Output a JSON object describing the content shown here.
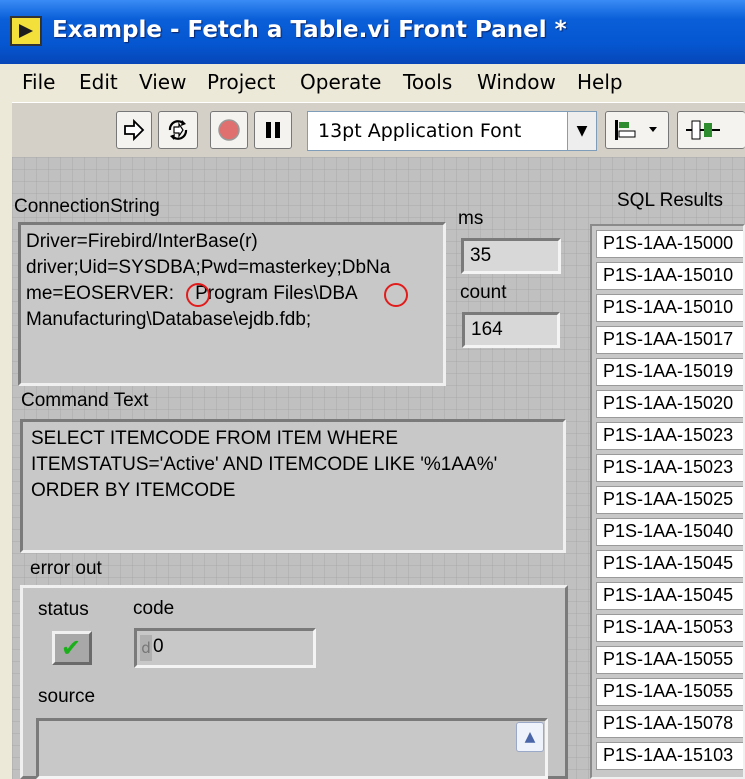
{
  "window": {
    "title": "Example - Fetch a Table.vi Front Panel *"
  },
  "menu": [
    "File",
    "Edit",
    "View",
    "Project",
    "Operate",
    "Tools",
    "Window",
    "Help"
  ],
  "toolbar": {
    "font": "13pt Application Font"
  },
  "connection": {
    "label": "ConnectionString",
    "value": "Driver=Firebird/InterBase(r)\ndriver;Uid=SYSDBA;Pwd=masterkey;DbNa\nme=EOSERVER:    Program Files\\DBA\nManufacturing\\Database\\ejdb.fdb;"
  },
  "ms": {
    "label": "ms",
    "value": "35"
  },
  "count": {
    "label": "count",
    "value": "164"
  },
  "command": {
    "label": "Command Text",
    "value": "SELECT ITEMCODE FROM ITEM WHERE\nITEMSTATUS='Active' AND ITEMCODE LIKE '%1AA%'\nORDER BY ITEMCODE"
  },
  "results": {
    "label": "SQL Results",
    "rows": [
      "P1S-1AA-15000",
      "P1S-1AA-15010",
      "P1S-1AA-15010",
      "P1S-1AA-15017",
      "P1S-1AA-15019",
      "P1S-1AA-15020",
      "P1S-1AA-15023",
      "P1S-1AA-15023",
      "P1S-1AA-15025",
      "P1S-1AA-15040",
      "P1S-1AA-15045",
      "P1S-1AA-15045",
      "P1S-1AA-15053",
      "P1S-1AA-15055",
      "P1S-1AA-15055",
      "P1S-1AA-15078",
      "P1S-1AA-15103"
    ]
  },
  "error_out": {
    "label": "error out",
    "status_label": "status",
    "code_label": "code",
    "radix": "d",
    "code_value": "0",
    "source_label": "source"
  }
}
